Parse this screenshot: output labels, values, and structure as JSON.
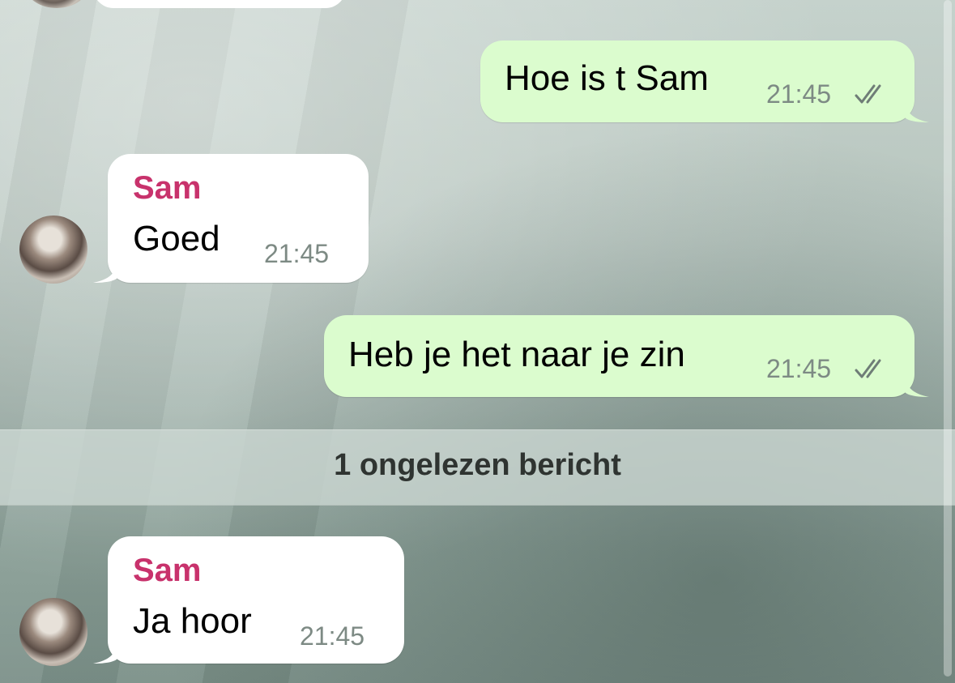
{
  "chat": {
    "unread_divider": "1 ongelezen bericht",
    "messages": [
      {
        "direction": "out",
        "text": "Hoe is t Sam",
        "time": "21:45",
        "status_icon": "double-check-icon"
      },
      {
        "direction": "in",
        "sender": "Sam",
        "text": "Goed",
        "time": "21:45",
        "avatar_icon": "contact-avatar"
      },
      {
        "direction": "out",
        "text": "Heb je het naar je zin",
        "time": "21:45",
        "status_icon": "double-check-icon"
      },
      {
        "direction": "in",
        "sender": "Sam",
        "text": "Ja hoor",
        "time": "21:45",
        "avatar_icon": "contact-avatar"
      }
    ]
  },
  "colors": {
    "outgoing_bubble": "#dbfcce",
    "incoming_bubble": "#ffffff",
    "sender_name": "#c8326c",
    "timestamp": "#7d8a84",
    "divider_text": "#2f3431"
  }
}
